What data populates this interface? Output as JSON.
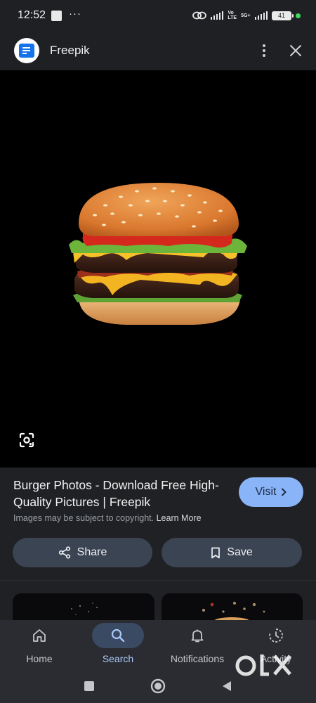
{
  "status_bar": {
    "time": "12:52",
    "more": "···",
    "network": "5G+",
    "battery": "41"
  },
  "header": {
    "site_name": "Freepik",
    "logo_icon": "freepik-logo",
    "menu_icon": "more-vert-icon",
    "close_icon": "close-icon"
  },
  "image": {
    "subject": "burger",
    "lens_icon": "google-lens-icon"
  },
  "result": {
    "title": "Burger Photos - Download Free High-Quality Pictures | Freepik",
    "visit_label": "Visit",
    "copyright_note": "Images may be subject to copyright.",
    "learn_more": "Learn More",
    "share_label": "Share",
    "save_label": "Save"
  },
  "bottom_nav": [
    {
      "label": "Home",
      "icon": "home-icon",
      "active": false
    },
    {
      "label": "Search",
      "icon": "search-icon",
      "active": true
    },
    {
      "label": "Notifications",
      "icon": "bell-icon",
      "active": false
    },
    {
      "label": "Activity",
      "icon": "activity-icon",
      "active": false
    }
  ],
  "watermark": "OLX",
  "colors": {
    "accent": "#8ab4f8",
    "background": "#202124",
    "pill": "#3b4452",
    "active_nav": "#3b4a63"
  }
}
